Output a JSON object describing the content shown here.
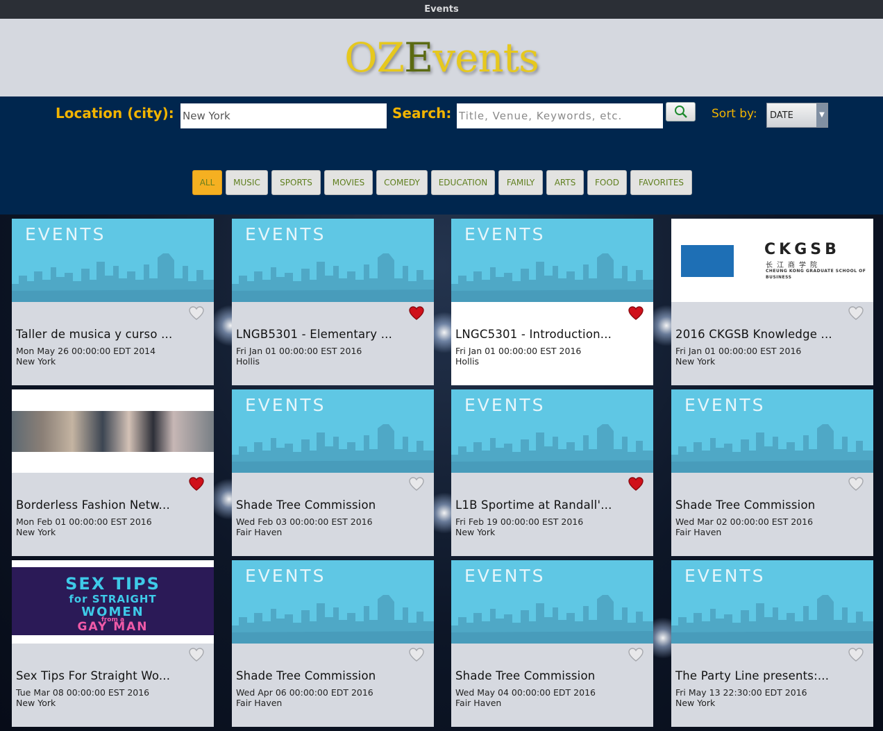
{
  "window": {
    "title": "Events"
  },
  "brand": {
    "logo_part1": "OZ",
    "logo_part2": "E",
    "logo_part3": "vents"
  },
  "search": {
    "location_label": "Location (city):",
    "location_value": "New York",
    "search_label": "Search:",
    "search_placeholder": "Title, Venue, Keywords, etc.",
    "sort_label": "Sort by:",
    "sort_value": "DATE"
  },
  "categories": [
    {
      "label": "ALL",
      "active": true
    },
    {
      "label": "MUSIC"
    },
    {
      "label": "SPORTS"
    },
    {
      "label": "MOVIES"
    },
    {
      "label": "COMEDY"
    },
    {
      "label": "EDUCATION"
    },
    {
      "label": "FAMILY"
    },
    {
      "label": "ARTS"
    },
    {
      "label": "FOOD"
    },
    {
      "label": "FAVORITES"
    }
  ],
  "thumb_text": "EVENTS",
  "ckgsb": {
    "title": "CKGSB",
    "chinese": "长江商学院",
    "subtitle": "CHEUNG KONG GRADUATE SCHOOL OF BUSINESS"
  },
  "poster": {
    "line1": "SEX TIPS",
    "line2": "for STRAIGHT",
    "line3": "WOMEN",
    "line4": "from a",
    "line5": "GAY MAN"
  },
  "colors": {
    "accent": "#f5b021",
    "header_bg": "#00264e",
    "favorite": "#d0101a",
    "logo_gold": "#e6c81e",
    "logo_olive": "#5b6a12"
  },
  "events": [
    {
      "title": "Taller de musica y curso ...",
      "date": "Mon May 26 00:00:00 EDT 2014",
      "location": "New York",
      "favorite": false,
      "image": "events-banner"
    },
    {
      "title": "LNGB5301 - Elementary ...",
      "date": "Fri Jan 01 00:00:00 EST 2016",
      "location": "Hollis",
      "favorite": true,
      "image": "events-banner"
    },
    {
      "title": "LNGC5301 - Introduction...",
      "date": "Fri Jan 01 00:00:00 EST 2016",
      "location": "Hollis",
      "favorite": true,
      "image": "events-banner"
    },
    {
      "title": "2016 CKGSB Knowledge ...",
      "date": "Fri Jan 01 00:00:00 EST 2016",
      "location": "New York",
      "favorite": false,
      "image": "ckgsb-logo"
    },
    {
      "title": "Borderless Fashion Netw...",
      "date": "Mon Feb 01 00:00:00 EST 2016",
      "location": "New York",
      "favorite": true,
      "image": "group-photo"
    },
    {
      "title": "Shade Tree Commission",
      "date": "Wed Feb 03 00:00:00 EST 2016",
      "location": "Fair Haven",
      "favorite": false,
      "image": "events-banner"
    },
    {
      "title": "L1B Sportime at Randall'...",
      "date": "Fri Feb 19 00:00:00 EST 2016",
      "location": "New York",
      "favorite": true,
      "image": "events-banner"
    },
    {
      "title": "Shade Tree Commission",
      "date": "Wed Mar 02 00:00:00 EST 2016",
      "location": "Fair Haven",
      "favorite": false,
      "image": "events-banner"
    },
    {
      "title": "Sex Tips For Straight Wo...",
      "date": "Tue Mar 08 00:00:00 EST 2016",
      "location": "New York",
      "favorite": false,
      "image": "show-poster"
    },
    {
      "title": "Shade Tree Commission",
      "date": "Wed Apr 06 00:00:00 EDT 2016",
      "location": "Fair Haven",
      "favorite": false,
      "image": "events-banner"
    },
    {
      "title": "Shade Tree Commission",
      "date": "Wed May 04 00:00:00 EDT 2016",
      "location": "Fair Haven",
      "favorite": false,
      "image": "events-banner"
    },
    {
      "title": "The Party Line presents:...",
      "date": "Fri May 13 22:30:00 EDT 2016",
      "location": "New York",
      "favorite": false,
      "image": "events-banner"
    }
  ]
}
